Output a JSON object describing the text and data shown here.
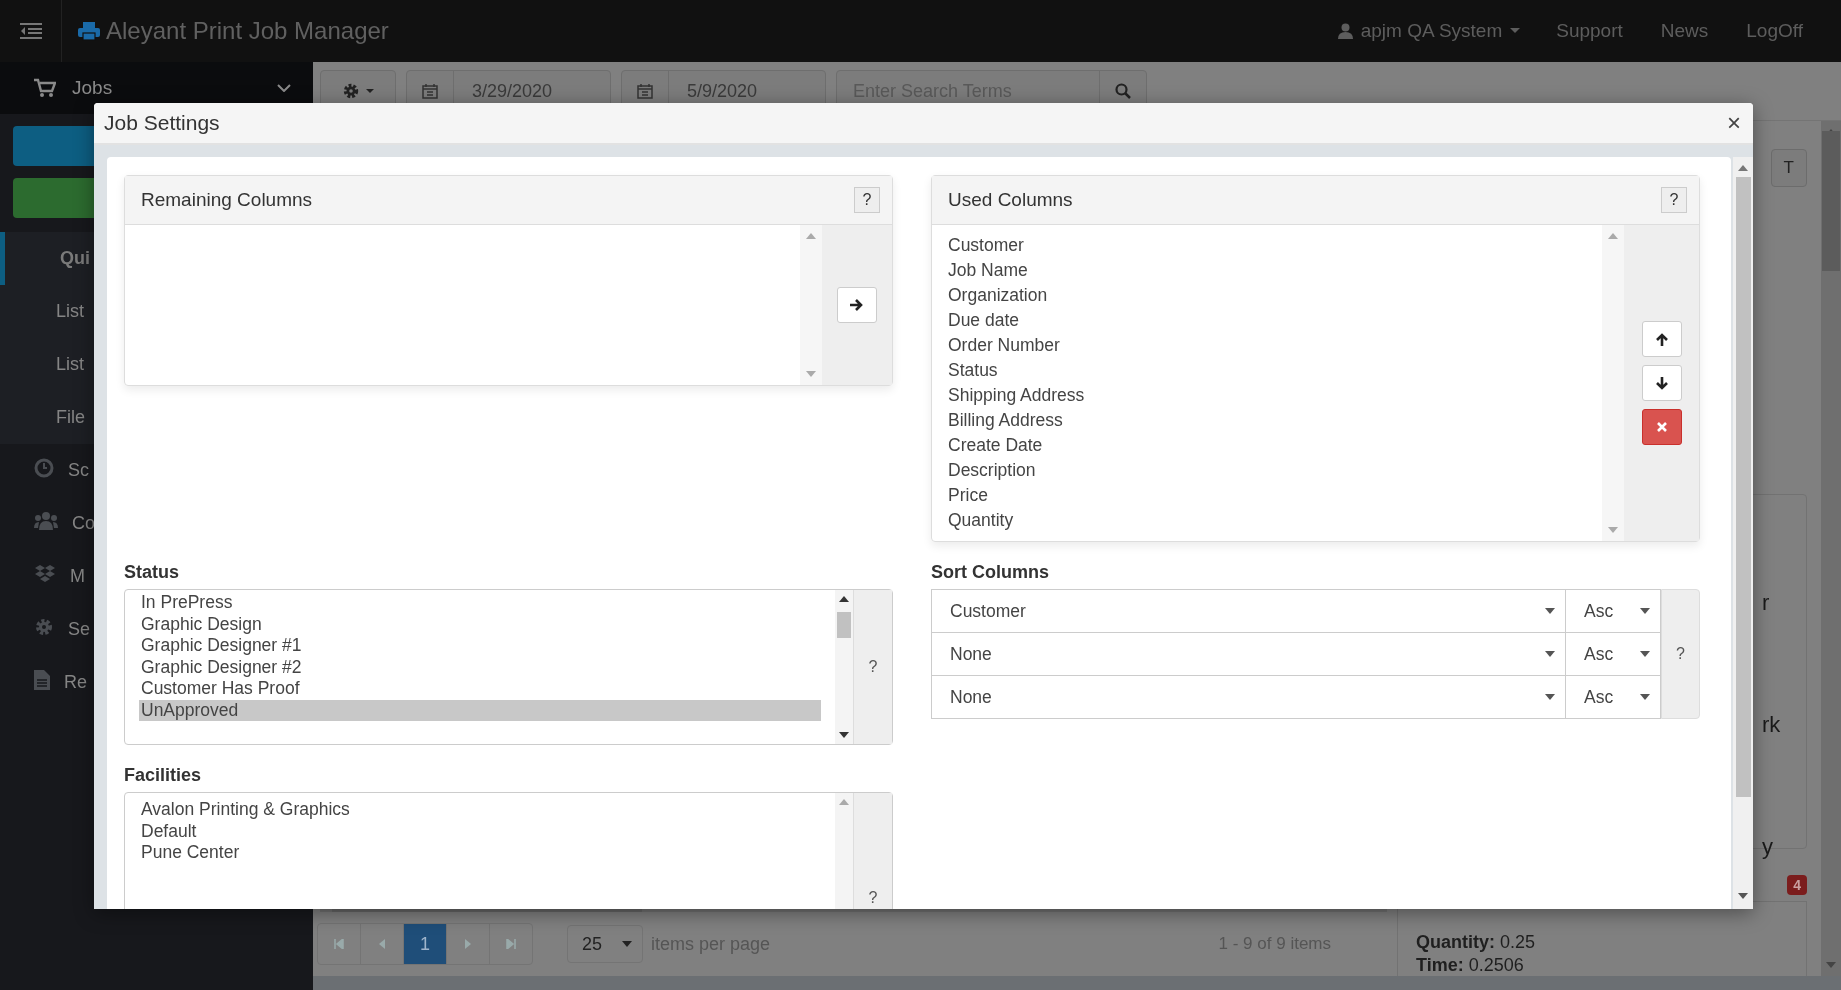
{
  "topbar": {
    "title": "Aleyant Print Job Manager",
    "user": "apjm QA System",
    "links": [
      "Support",
      "News",
      "LogOff"
    ]
  },
  "sidebar": {
    "section": "Jobs",
    "items": [
      {
        "label": "Qui",
        "kind": "sub",
        "selected": true
      },
      {
        "label": "List",
        "kind": "sub",
        "selected": false
      },
      {
        "label": "List",
        "kind": "sub",
        "selected": false
      },
      {
        "label": "File",
        "kind": "sub",
        "selected": false
      },
      {
        "label": "Sc",
        "kind": "main",
        "selected": false
      },
      {
        "label": "Co",
        "kind": "main",
        "selected": false
      },
      {
        "label": "M",
        "kind": "main",
        "selected": false
      },
      {
        "label": "Se",
        "kind": "main",
        "selected": false
      },
      {
        "label": "Re",
        "kind": "main",
        "selected": false
      }
    ]
  },
  "toolbar": {
    "date_from": "3/29/2020",
    "date_to": "5/9/2020",
    "search_placeholder": "Enter Search Terms"
  },
  "right_panel": {
    "ticket_button": "T",
    "fragments": [
      "r",
      "rk",
      "y"
    ],
    "badge": "4",
    "details": [
      {
        "label": "Quantity:",
        "value": "0.25"
      },
      {
        "label": "Time:",
        "value": "0.2506"
      }
    ]
  },
  "pager": {
    "pages": [
      {
        "label": "1",
        "selected": true
      }
    ],
    "page_size": "25",
    "page_size_label": "items per page",
    "summary": "1 - 9 of 9 items"
  },
  "modal": {
    "title": "Job Settings",
    "close": "×",
    "remaining": {
      "title": "Remaining Columns",
      "help": "?"
    },
    "used": {
      "title": "Used Columns",
      "help": "?",
      "items": [
        "Customer",
        "Job Name",
        "Organization",
        "Due date",
        "Order Number",
        "Status",
        "Shipping Address",
        "Billing Address",
        "Create Date",
        "Description",
        "Price",
        "Quantity"
      ]
    },
    "status": {
      "label": "Status",
      "help": "?",
      "items": [
        {
          "label": "In PrePress",
          "selected": false
        },
        {
          "label": "Graphic Design",
          "selected": false
        },
        {
          "label": "Graphic Designer #1",
          "selected": false
        },
        {
          "label": "Graphic Designer #2",
          "selected": false
        },
        {
          "label": "Customer Has Proof",
          "selected": false
        },
        {
          "label": "UnApproved",
          "selected": true
        }
      ]
    },
    "sort": {
      "label": "Sort Columns",
      "help": "?",
      "rows": [
        {
          "field": "Customer",
          "direction": "Asc"
        },
        {
          "field": "None",
          "direction": "Asc"
        },
        {
          "field": "None",
          "direction": "Asc"
        }
      ]
    },
    "facilities": {
      "label": "Facilities",
      "help": "?",
      "items": [
        "Avalon Printing & Graphics",
        "Default",
        "Pune Center"
      ]
    }
  }
}
